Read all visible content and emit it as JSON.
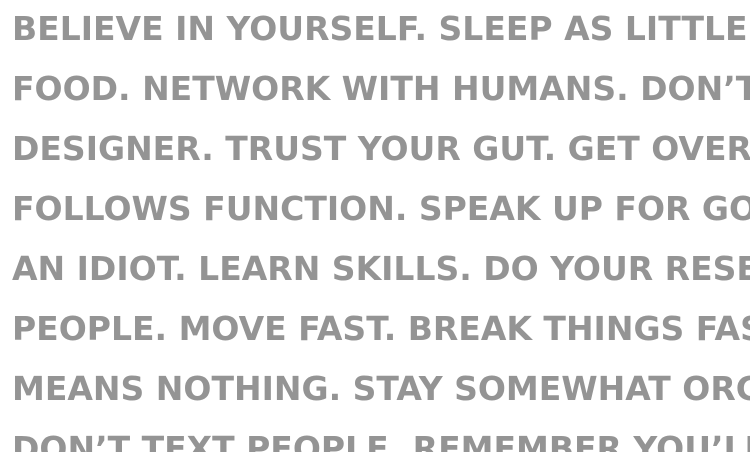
{
  "lines": [
    "BELIEVE IN YOURSELF. SLEEP AS LITTLE AS PO",
    "FOOD. NETWORK WITH HUMANS. DON’T PRE",
    "DESIGNER. TRUST YOUR GUT. GET OVER YOU",
    "FOLLOWS FUNCTION. SPEAK UP FOR GOOD I",
    "AN IDIOT. LEARN SKILLS. DO YOUR RESEARCH",
    "PEOPLE. MOVE FAST. BREAK THINGS FASTER.",
    "MEANS NOTHING. STAY SOMEWHAT ORGANI",
    "DON’T TEXT PEOPLE. REMEMBER YOU’LL BE I"
  ],
  "colors": {
    "text": "#949494",
    "background": "#ffffff"
  }
}
